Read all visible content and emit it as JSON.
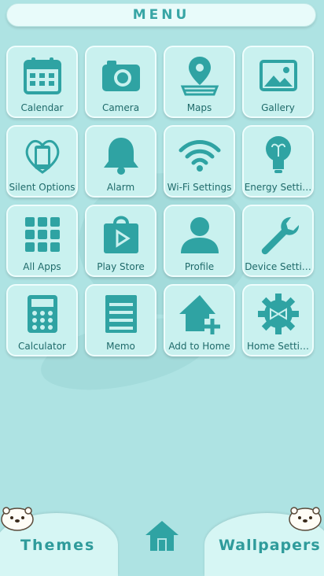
{
  "header": {
    "title": "MENU"
  },
  "tiles": [
    {
      "label": "Calendar",
      "icon": "calendar-icon"
    },
    {
      "label": "Camera",
      "icon": "camera-icon"
    },
    {
      "label": "Maps",
      "icon": "map-pin-icon"
    },
    {
      "label": "Gallery",
      "icon": "gallery-icon"
    },
    {
      "label": "Silent Options",
      "icon": "silent-phone-icon"
    },
    {
      "label": "Alarm",
      "icon": "bell-icon"
    },
    {
      "label": "Wi-Fi Settings",
      "icon": "wifi-icon"
    },
    {
      "label": "Energy Setti…",
      "icon": "lightbulb-icon"
    },
    {
      "label": "All Apps",
      "icon": "apps-grid-icon"
    },
    {
      "label": "Play Store",
      "icon": "play-store-icon"
    },
    {
      "label": "Profile",
      "icon": "profile-icon"
    },
    {
      "label": "Device Setti…",
      "icon": "wrench-icon"
    },
    {
      "label": "Calculator",
      "icon": "calculator-icon"
    },
    {
      "label": "Memo",
      "icon": "memo-icon"
    },
    {
      "label": "Add to Home",
      "icon": "add-home-icon"
    },
    {
      "label": "Home Setti…",
      "icon": "gear-icon"
    }
  ],
  "footer": {
    "themes_label": "Themes",
    "wallpapers_label": "Wallpapers",
    "home_icon": "home-icon"
  },
  "colors": {
    "background": "#aee3e3",
    "tile": "#c9f1ef",
    "icon": "#2fa3a3",
    "label": "#1f6a6a"
  }
}
